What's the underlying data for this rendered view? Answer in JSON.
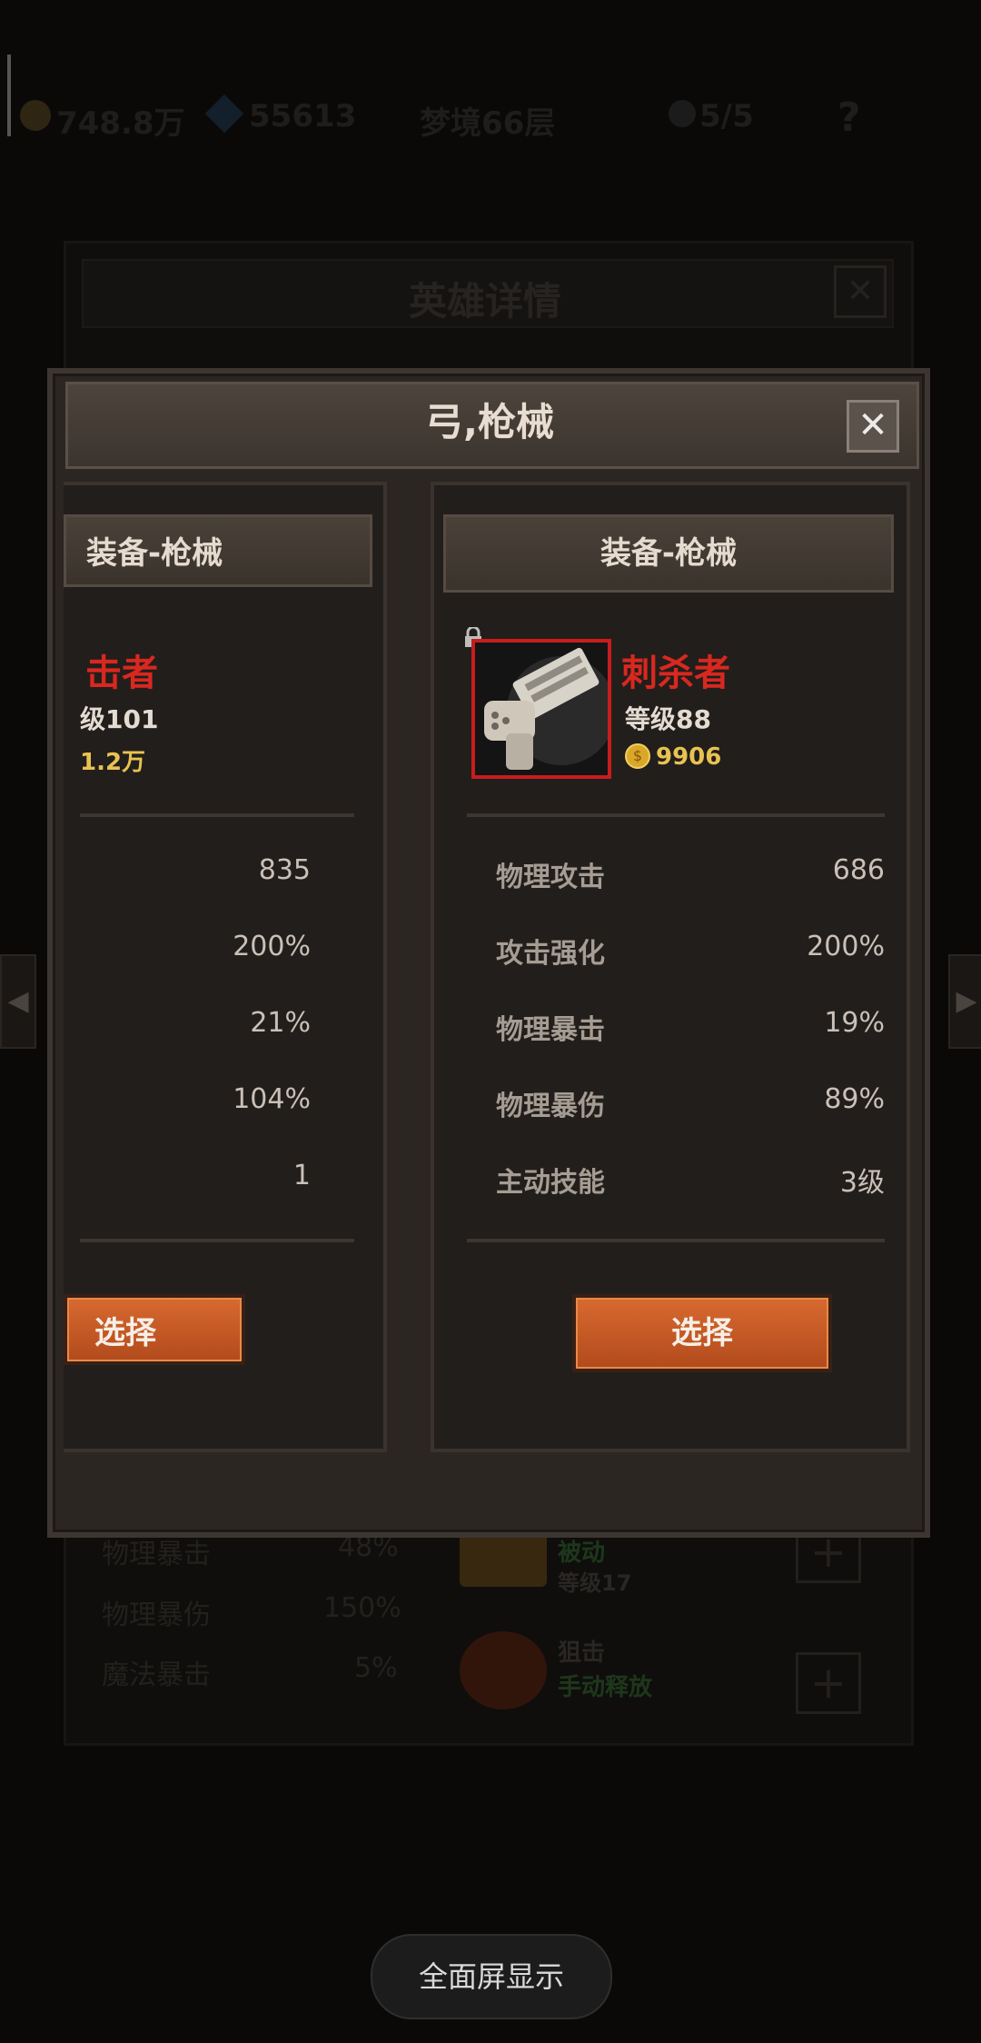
{
  "hud": {
    "gold": "748.8万",
    "gems": "55613",
    "stage": "梦境66层",
    "skull": "5/5",
    "help": "?"
  },
  "background_window": {
    "title": "英雄详情",
    "stats": [
      {
        "label": "物理暴击",
        "value": "48%"
      },
      {
        "label": "物理暴伤",
        "value": "150%"
      },
      {
        "label": "魔法暴击",
        "value": "5%"
      }
    ],
    "skills": [
      {
        "type": "被动",
        "level": "等级17"
      },
      {
        "name": "狙击",
        "type": "手动释放"
      }
    ]
  },
  "dialog": {
    "title": "弓,枪械",
    "close": "✕"
  },
  "left_card": {
    "header": "装备-枪械",
    "name": "击者",
    "level": "级101",
    "price": "1.2万",
    "values": [
      "835",
      "200%",
      "21%",
      "104%",
      "1"
    ],
    "select": "选择"
  },
  "right_card": {
    "header": "装备-枪械",
    "name": "刺杀者",
    "level": "等级88",
    "price": "9906",
    "stats": [
      {
        "label": "物理攻击",
        "value": "686"
      },
      {
        "label": "攻击强化",
        "value": "200%"
      },
      {
        "label": "物理暴击",
        "value": "19%"
      },
      {
        "label": "物理暴伤",
        "value": "89%"
      },
      {
        "label": "主动技能",
        "value": "3级"
      }
    ],
    "select": "选择"
  },
  "fullscreen": "全面屏显示",
  "colors": {
    "name_red": "#d82820",
    "gold": "#e8c252",
    "button_orange": "#c8581f"
  }
}
